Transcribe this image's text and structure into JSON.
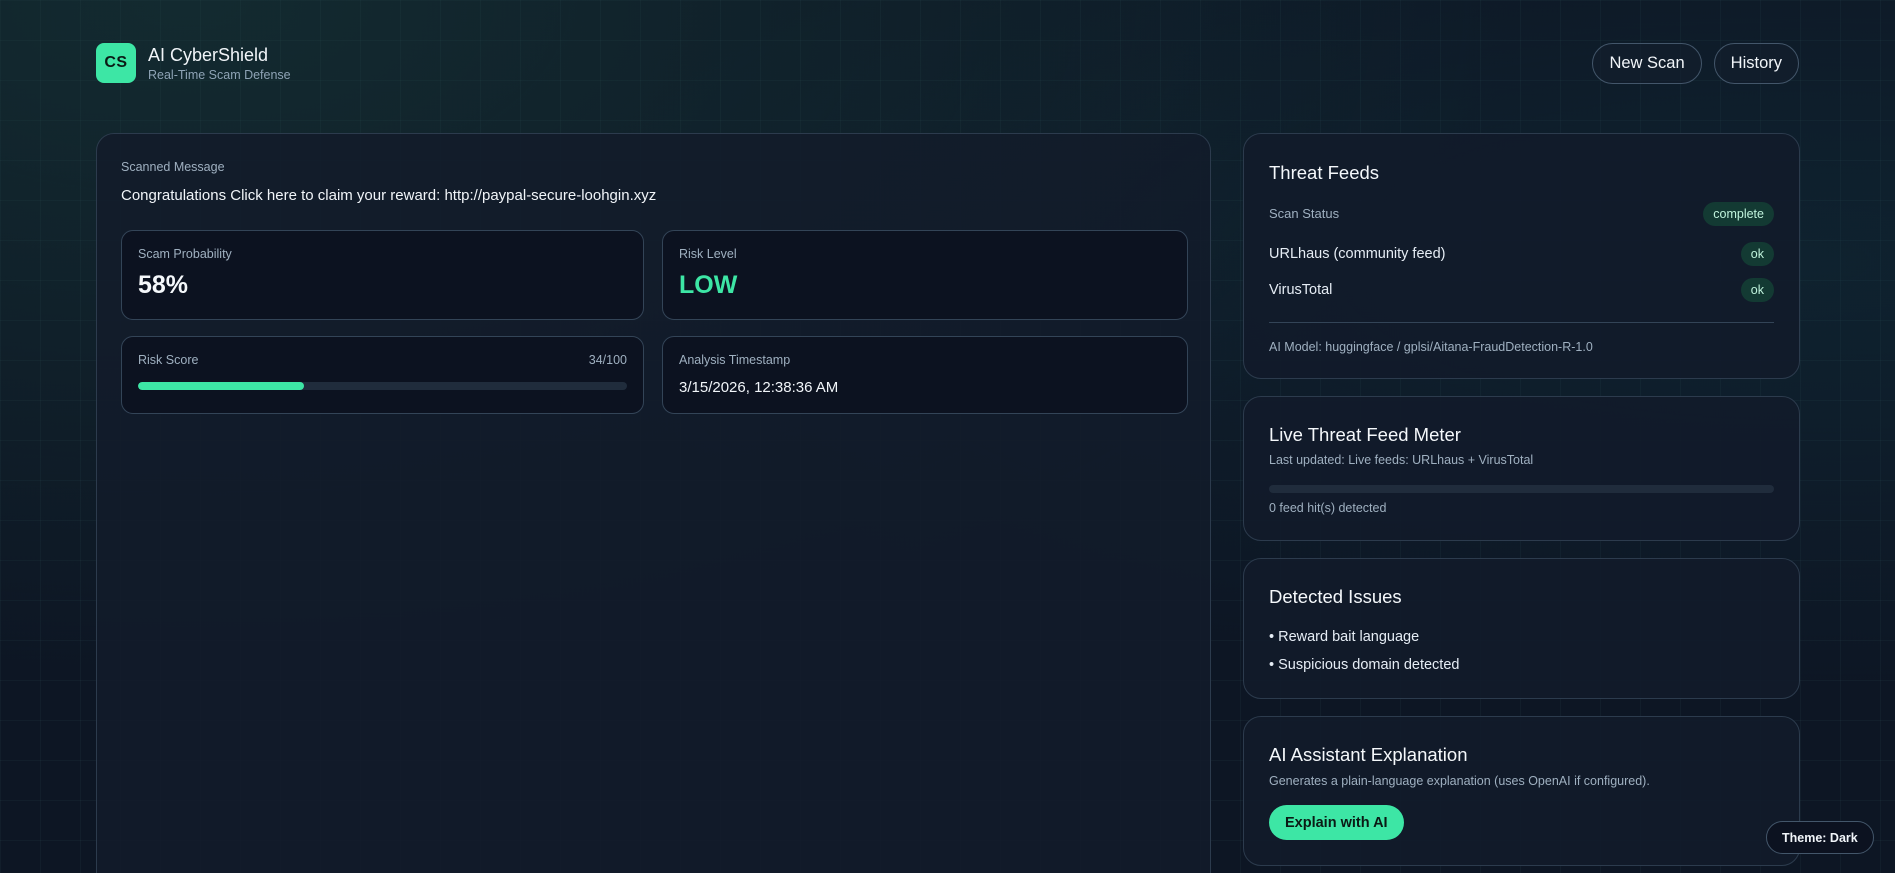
{
  "header": {
    "logo_text": "CS",
    "app_name": "AI CyberShield",
    "tagline": "Real-Time Scam Defense",
    "nav": {
      "new_scan": "New Scan",
      "history": "History"
    }
  },
  "scan": {
    "label": "Scanned Message",
    "message": "Congratulations Click here to claim your reward: http://paypal-secure-loohgin.xyz"
  },
  "metrics": {
    "probability": {
      "label": "Scam Probability",
      "value": "58%"
    },
    "risk_level": {
      "label": "Risk Level",
      "value": "LOW",
      "color": "#3de6a5"
    },
    "risk_score": {
      "label": "Risk Score",
      "value": "34/100",
      "fraction": 0.34
    },
    "timestamp": {
      "label": "Analysis Timestamp",
      "value": "3/15/2026, 12:38:36 AM"
    }
  },
  "threat_feeds": {
    "title": "Threat Feeds",
    "scan_status_label": "Scan Status",
    "scan_status": "complete",
    "feeds": [
      {
        "name": "URLhaus (community feed)",
        "status": "ok"
      },
      {
        "name": "VirusTotal",
        "status": "ok"
      }
    ],
    "model": "AI Model: huggingface / gplsi/Aitana-FraudDetection-R-1.0"
  },
  "meter": {
    "title": "Live Threat Feed Meter",
    "updated": "Last updated: Live feeds: URLhaus + VirusTotal",
    "fraction": 0,
    "hits": "0 feed hit(s) detected"
  },
  "issues": {
    "title": "Detected Issues",
    "items": [
      "• Reward bait language",
      "• Suspicious domain detected"
    ]
  },
  "assistant": {
    "title": "AI Assistant Explanation",
    "description": "Generates a plain-language explanation (uses OpenAI if configured).",
    "button": "Explain with AI"
  },
  "theme_toggle": "Theme: Dark",
  "colors": {
    "accent": "#3de6a5",
    "background": "#0d1624",
    "panel": "#121b2a"
  }
}
